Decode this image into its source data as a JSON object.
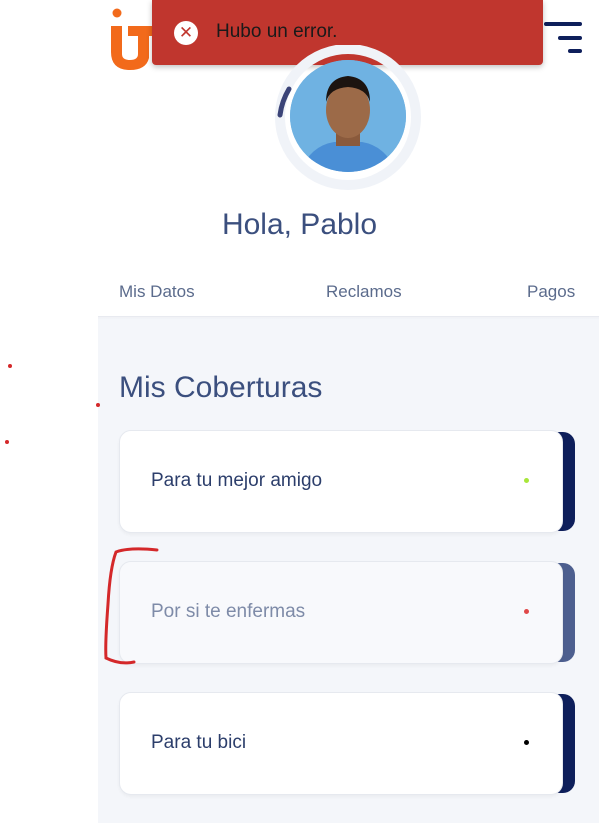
{
  "toast": {
    "message": "Hubo un error.",
    "icon": "error-icon",
    "color": "#c0362e"
  },
  "header": {
    "logo": "ut-logo",
    "menu_icon": "hamburger-menu-icon"
  },
  "profile": {
    "greeting": "Hola, Pablo",
    "avatar": "user-avatar-photo"
  },
  "tabs": [
    {
      "label": "Mis Datos"
    },
    {
      "label": "Reclamos"
    },
    {
      "label": "Pagos"
    }
  ],
  "coverages": {
    "title": "Mis Coberturas",
    "items": [
      {
        "label": "Para tu mejor amigo",
        "dot_color": "#a8e63a",
        "accent_color": "#0e1f5b",
        "active": true
      },
      {
        "label": "Por si te enfermas",
        "dot_color": "#e04848",
        "accent_color": "#4d5f8f",
        "active": false
      },
      {
        "label": "Para tu bici",
        "dot_color": "#000000",
        "accent_color": "#0e1f5b",
        "active": true
      }
    ]
  },
  "colors": {
    "brand_orange": "#f26a1b",
    "navy": "#0e1f5b",
    "text": "#3b4f7e"
  }
}
